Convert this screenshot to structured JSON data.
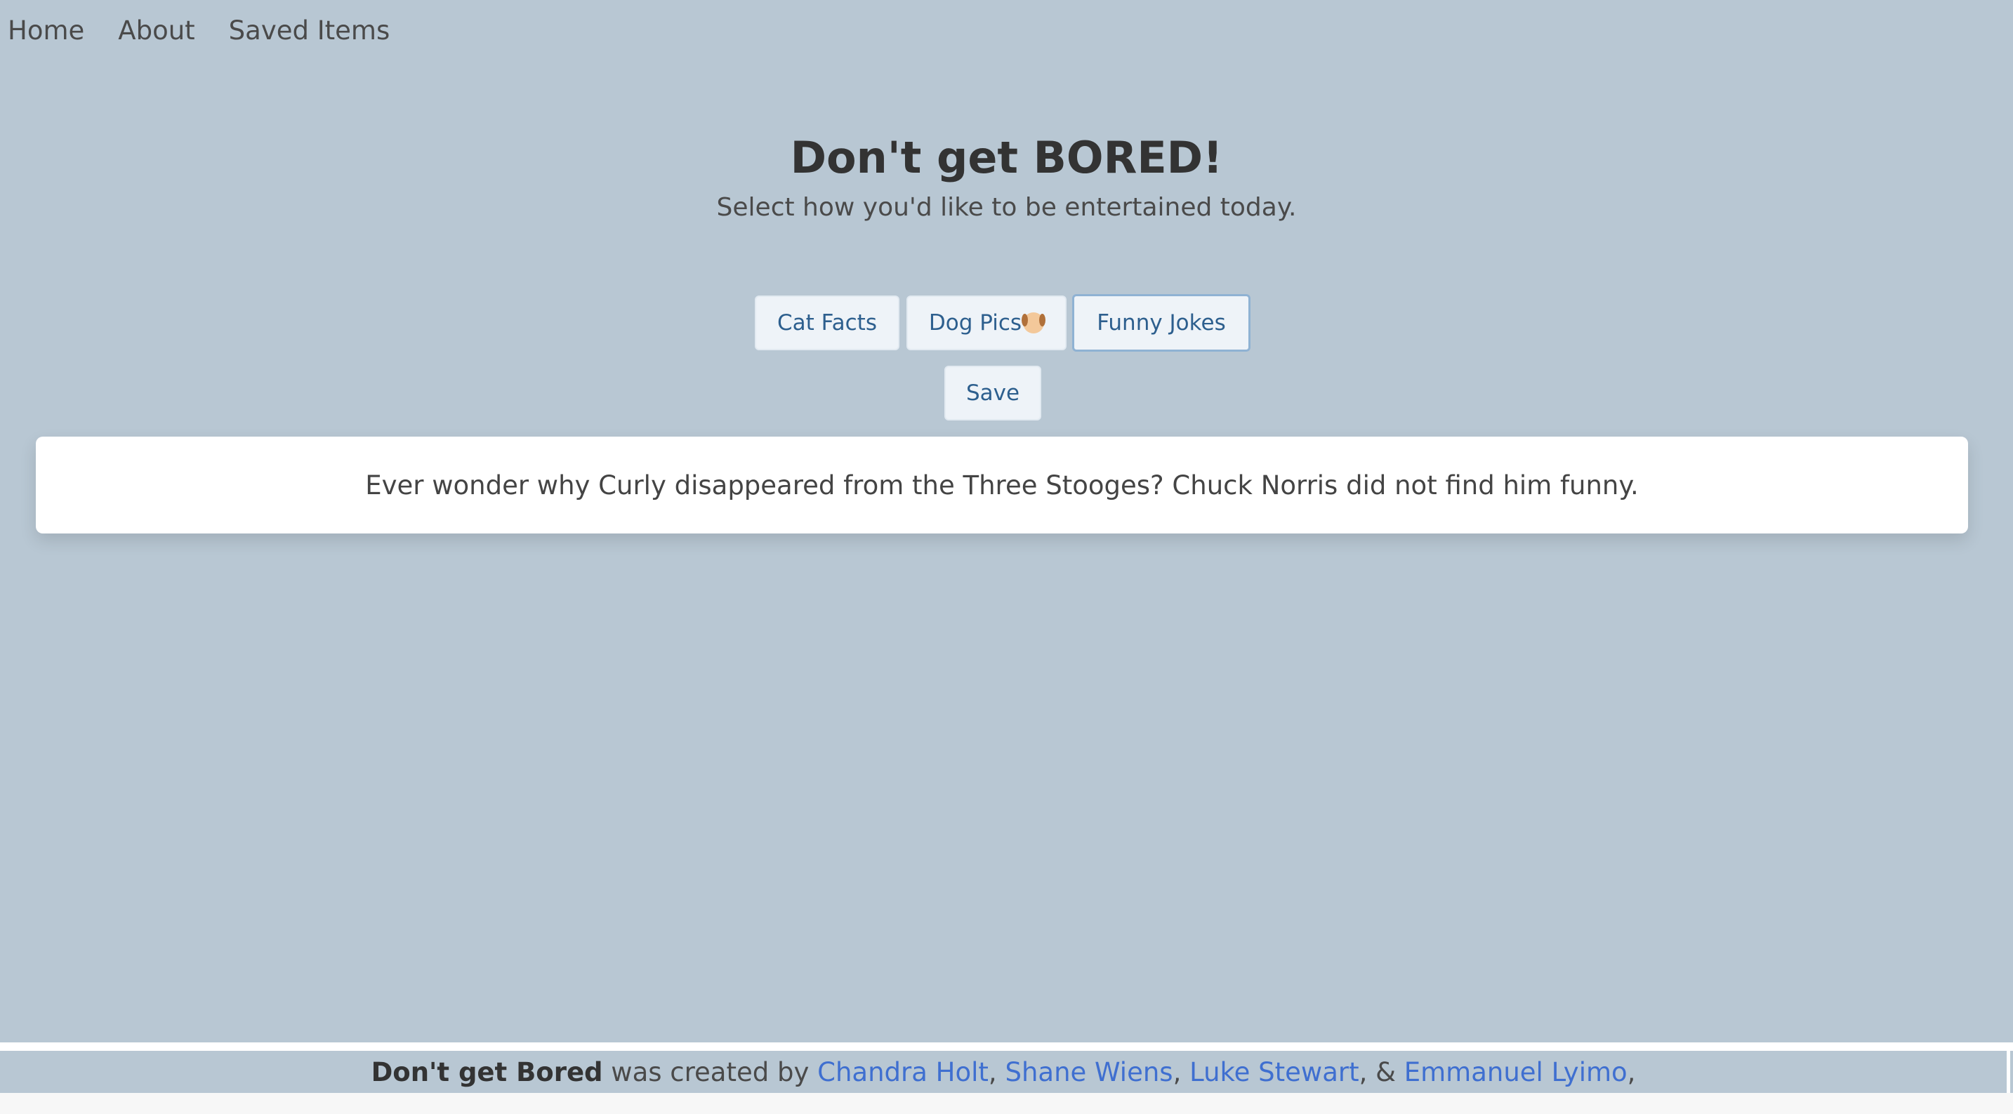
{
  "nav": {
    "home": "Home",
    "about": "About",
    "saved": "Saved Items"
  },
  "header": {
    "title": "Don't get BORED!",
    "subtitle": "Select how you'd like to be entertained today."
  },
  "buttons": {
    "cat": "Cat Facts",
    "dog": "Dog Pics",
    "dog_icon": "dog-face-icon",
    "jokes": "Funny Jokes",
    "save": "Save"
  },
  "content": {
    "joke": "Ever wonder why Curly disappeared from the Three Stooges? Chuck Norris did not find him funny."
  },
  "footer": {
    "brand": "Don't get Bored",
    "text": " was created by ",
    "authors": [
      "Chandra Holt",
      "Shane Wiens",
      "Luke Stewart",
      "Emmanuel Lyimo"
    ],
    "sep": ", ",
    "amp": ", & ",
    "end": ","
  },
  "colors": {
    "background": "#b8c7d3",
    "button_text": "#2d5f8e",
    "link": "#3f6fd0"
  }
}
